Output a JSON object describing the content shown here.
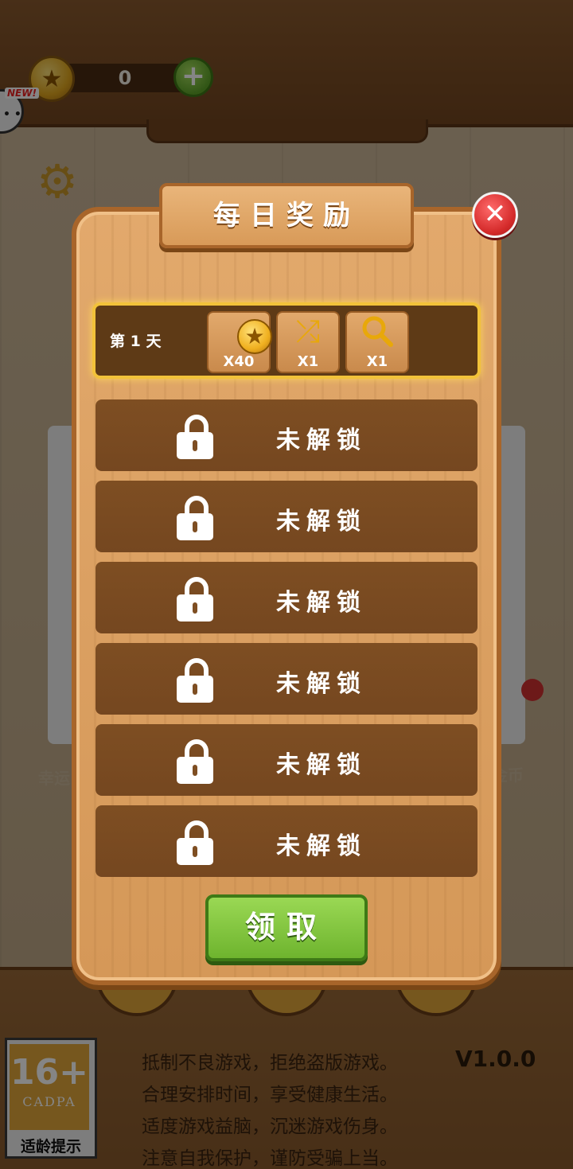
{
  "hud": {
    "coins": "0",
    "new_badge": "NEW!"
  },
  "background": {
    "side_label_left": "幸运",
    "side_label_right": "金币",
    "notice_lines": [
      "抵制不良游戏，拒绝盗版游戏。",
      "合理安排时间，享受健康生活。",
      "适度游戏益脑，沉迷游戏伤身。",
      "注意自我保护，谨防受骗上当。"
    ],
    "version": "V1.0.0",
    "age_rating": {
      "number": "16+",
      "org": "CADPA",
      "caption": "适龄提示"
    }
  },
  "dialog": {
    "title": "每日奖励",
    "day1": {
      "label": "第 1 天",
      "rewards": [
        {
          "icon": "star-coin-icon",
          "qty": "X40"
        },
        {
          "icon": "shuffle-icon",
          "qty": "X1"
        },
        {
          "icon": "magnifier-icon",
          "qty": "X1"
        }
      ]
    },
    "locked_label": "未解锁",
    "locked_rows": 6,
    "claim_label": "领取"
  },
  "colors": {
    "accent_gold": "#f2c23a",
    "claim_green": "#6eb42e",
    "close_red": "#d42a2a",
    "wood": "#dba062"
  }
}
